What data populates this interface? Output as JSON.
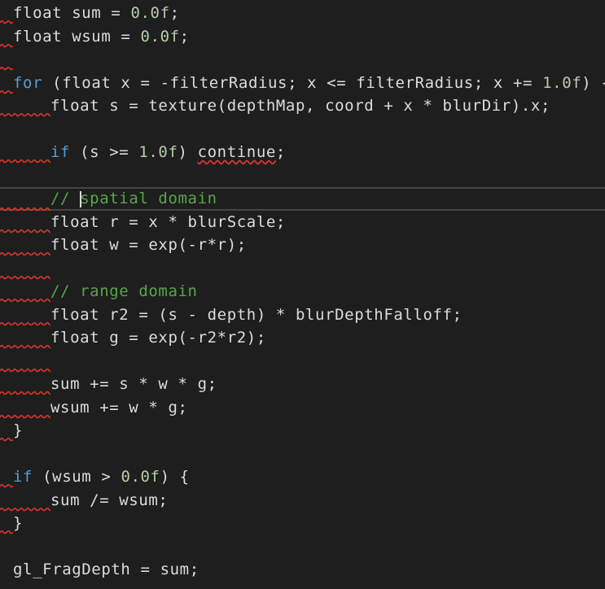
{
  "editor": {
    "language": "glsl",
    "colors": {
      "background": "#1e1e1e",
      "text": "#dcdcdc",
      "keyword": "#569cd6",
      "number": "#b5cea8",
      "comment": "#57a64a",
      "error_squiggle": "#d7362e",
      "current_line_border": "#464646"
    },
    "lines": [
      {
        "indent": 0,
        "tokens": [
          {
            "t": "float sum = ",
            "c": ""
          },
          {
            "t": "0.0f",
            "c": "num"
          },
          {
            "t": ";",
            "c": ""
          }
        ],
        "squiggle": "short"
      },
      {
        "indent": 0,
        "tokens": [
          {
            "t": "float wsum = ",
            "c": ""
          },
          {
            "t": "0.0f",
            "c": "num"
          },
          {
            "t": ";",
            "c": ""
          }
        ],
        "squiggle": "short"
      },
      {
        "indent": 0,
        "tokens": [],
        "squiggle": "short"
      },
      {
        "indent": 0,
        "tokens": [
          {
            "t": "for",
            "c": "kw"
          },
          {
            "t": " (float x = -filterRadius; x <= filterRadius; x += ",
            "c": ""
          },
          {
            "t": "1.0f",
            "c": "num"
          },
          {
            "t": ") {",
            "c": ""
          }
        ],
        "squiggle": "short"
      },
      {
        "indent": 1,
        "tokens": [
          {
            "t": "float s = texture(depthMap, coord + x * blurDir).x;",
            "c": ""
          }
        ],
        "squiggle": "long"
      },
      {
        "indent": 0,
        "tokens": [],
        "squiggle": ""
      },
      {
        "indent": 1,
        "tokens": [
          {
            "t": "if",
            "c": "kw"
          },
          {
            "t": " (s >= ",
            "c": ""
          },
          {
            "t": "1.0f",
            "c": "num"
          },
          {
            "t": ") ",
            "c": ""
          },
          {
            "t": "continue",
            "c": "err"
          },
          {
            "t": ";",
            "c": ""
          }
        ],
        "squiggle": "long"
      },
      {
        "indent": 0,
        "tokens": [],
        "squiggle": ""
      },
      {
        "indent": 1,
        "tokens": [
          {
            "t": "// ",
            "c": "cm"
          },
          {
            "t": "",
            "c": "caret"
          },
          {
            "t": "spatial domain",
            "c": "cm"
          }
        ],
        "squiggle": "long",
        "current": true
      },
      {
        "indent": 1,
        "tokens": [
          {
            "t": "float r = x * blurScale;",
            "c": ""
          }
        ],
        "squiggle": "long"
      },
      {
        "indent": 1,
        "tokens": [
          {
            "t": "float w = exp(-r*r);",
            "c": ""
          }
        ],
        "squiggle": "long"
      },
      {
        "indent": 0,
        "tokens": [],
        "squiggle": "long"
      },
      {
        "indent": 1,
        "tokens": [
          {
            "t": "// range domain",
            "c": "cm"
          }
        ],
        "squiggle": "long"
      },
      {
        "indent": 1,
        "tokens": [
          {
            "t": "float r2 = (s - depth) * blurDepthFalloff;",
            "c": ""
          }
        ],
        "squiggle": "long"
      },
      {
        "indent": 1,
        "tokens": [
          {
            "t": "float g = exp(-r2*r2);",
            "c": ""
          }
        ],
        "squiggle": "long"
      },
      {
        "indent": 0,
        "tokens": [],
        "squiggle": "long"
      },
      {
        "indent": 1,
        "tokens": [
          {
            "t": "sum += s * w * g;",
            "c": ""
          }
        ],
        "squiggle": "long"
      },
      {
        "indent": 1,
        "tokens": [
          {
            "t": "wsum += w * g;",
            "c": ""
          }
        ],
        "squiggle": "long"
      },
      {
        "indent": 0,
        "tokens": [
          {
            "t": "}",
            "c": ""
          }
        ],
        "squiggle": "short"
      },
      {
        "indent": 0,
        "tokens": [],
        "squiggle": ""
      },
      {
        "indent": 0,
        "tokens": [
          {
            "t": "if",
            "c": "kw"
          },
          {
            "t": " (wsum > ",
            "c": ""
          },
          {
            "t": "0.0f",
            "c": "num"
          },
          {
            "t": ") {",
            "c": ""
          }
        ],
        "squiggle": "short"
      },
      {
        "indent": 1,
        "tokens": [
          {
            "t": "sum /= wsum;",
            "c": ""
          }
        ],
        "squiggle": "long"
      },
      {
        "indent": 0,
        "tokens": [
          {
            "t": "}",
            "c": ""
          }
        ],
        "squiggle": "short"
      },
      {
        "indent": 0,
        "tokens": [],
        "squiggle": ""
      },
      {
        "indent": 0,
        "tokens": [
          {
            "t": "gl_FragDepth = sum;",
            "c": ""
          }
        ],
        "squiggle": ""
      }
    ]
  }
}
